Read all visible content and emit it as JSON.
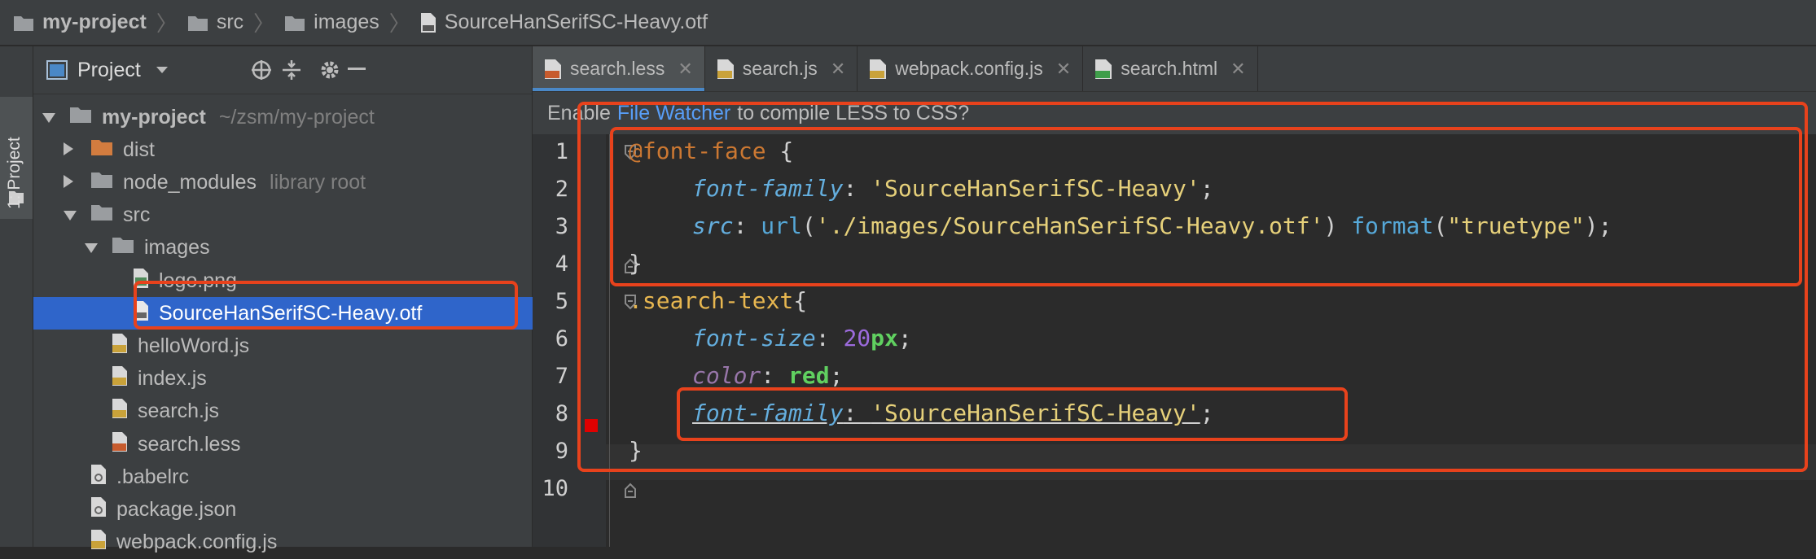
{
  "breadcrumb": {
    "items": [
      "my-project",
      "src",
      "images",
      "SourceHanSerifSC-Heavy.otf"
    ]
  },
  "tool_stripe": {
    "label": "1: Project"
  },
  "project_panel": {
    "title": "Project",
    "tree": [
      {
        "label": "my-project",
        "hint": "~/zsm/my-project",
        "kind": "folder",
        "indent": 0,
        "expanded": true
      },
      {
        "label": "dist",
        "hint": "",
        "kind": "folder-orange",
        "indent": 1,
        "expanded": false
      },
      {
        "label": "node_modules",
        "hint": "library root",
        "kind": "folder",
        "indent": 1,
        "expanded": false
      },
      {
        "label": "src",
        "hint": "",
        "kind": "folder",
        "indent": 1,
        "expanded": true
      },
      {
        "label": "images",
        "hint": "",
        "kind": "folder",
        "indent": 2,
        "expanded": true
      },
      {
        "label": "logo.png",
        "hint": "",
        "kind": "image",
        "indent": 3
      },
      {
        "label": "SourceHanSerifSC-Heavy.otf",
        "hint": "",
        "kind": "otf",
        "indent": 3,
        "selected": true
      },
      {
        "label": "helloWord.js",
        "hint": "",
        "kind": "js",
        "indent": 2
      },
      {
        "label": "index.js",
        "hint": "",
        "kind": "js",
        "indent": 2
      },
      {
        "label": "search.js",
        "hint": "",
        "kind": "js",
        "indent": 2
      },
      {
        "label": "search.less",
        "hint": "",
        "kind": "less",
        "indent": 2
      },
      {
        "label": ".babelrc",
        "hint": "",
        "kind": "config",
        "indent": 1
      },
      {
        "label": "package.json",
        "hint": "",
        "kind": "config",
        "indent": 1
      },
      {
        "label": "webpack.config.js",
        "hint": "",
        "kind": "js",
        "indent": 1
      }
    ]
  },
  "tabs": [
    {
      "label": "search.less",
      "icon": "less",
      "active": true
    },
    {
      "label": "search.js",
      "icon": "js",
      "active": false
    },
    {
      "label": "webpack.config.js",
      "icon": "js",
      "active": false
    },
    {
      "label": "search.html",
      "icon": "html",
      "active": false
    }
  ],
  "notice": {
    "prefix": "Enable",
    "link": "File Watcher",
    "suffix": "to compile LESS to CSS?"
  },
  "line_numbers": [
    "1",
    "2",
    "3",
    "4",
    "5",
    "6",
    "7",
    "8",
    "9",
    "10"
  ],
  "code": {
    "l1_at": "@font-face",
    "l1_brace": " {",
    "l2_prop": "font-family",
    "l2_colon": ": ",
    "l2_val": "'SourceHanSerifSC-Heavy'",
    "l2_semi": ";",
    "l3_prop": "src",
    "l3_colon": ": ",
    "l3_fn1": "url",
    "l3_p1": "(",
    "l3_str1": "'./images/SourceHanSerifSC-Heavy.otf'",
    "l3_p2": ") ",
    "l3_fn2": "format",
    "l3_p3": "(",
    "l3_str2": "\"truetype\"",
    "l3_p4": ");",
    "l4": "}",
    "l5_sel": ".search-text",
    "l5_brace": "{",
    "l6_prop": "font-size",
    "l6_colon": ": ",
    "l6_num": "20",
    "l6_unit": "px",
    "l6_semi": ";",
    "l7_prop": "color",
    "l7_colon": ": ",
    "l7_val": "red",
    "l7_semi": ";",
    "l8_prop": "font-family",
    "l8_colon": ": ",
    "l8_val": "'SourceHanSerifSC-Heavy'",
    "l8_semi": ";",
    "l9": "}"
  },
  "colors": {
    "selection": "#2f65ca",
    "annotation": "#e8421c",
    "link": "#589df6"
  }
}
